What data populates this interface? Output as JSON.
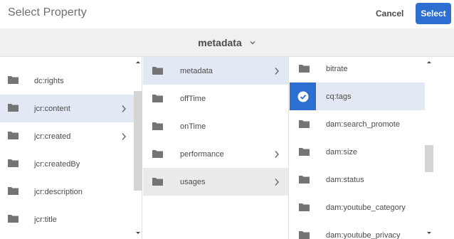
{
  "header": {
    "title": "Select Property",
    "cancel_label": "Cancel",
    "select_label": "Select"
  },
  "breadcrumb": {
    "label": "metadata"
  },
  "columns": {
    "col1": [
      {
        "label": "dc:rights"
      },
      {
        "label": "jcr:content"
      },
      {
        "label": "jcr:created"
      },
      {
        "label": "jcr:createdBy"
      },
      {
        "label": "jcr:description"
      },
      {
        "label": "jcr:title"
      }
    ],
    "col2": [
      {
        "label": "metadata"
      },
      {
        "label": "offTime"
      },
      {
        "label": "onTime"
      },
      {
        "label": "performance"
      },
      {
        "label": "usages"
      }
    ],
    "col3": [
      {
        "label": "bitrate"
      },
      {
        "label": "cq:tags"
      },
      {
        "label": "dam:search_promote"
      },
      {
        "label": "dam:size"
      },
      {
        "label": "dam:status"
      },
      {
        "label": "dam:youtube_category"
      },
      {
        "label": "dam:youtube_privacy"
      }
    ]
  },
  "colors": {
    "accent": "#2c6fd1",
    "highlight": "#e3e9f4",
    "selected_gray": "#ebebeb",
    "breadcrumb_bg": "#f0f0f0"
  },
  "icons": {
    "folder": "folder-icon",
    "chevron_right": "chevron-right-icon",
    "chevron_down": "chevron-down-icon",
    "check": "checkmark-icon"
  }
}
